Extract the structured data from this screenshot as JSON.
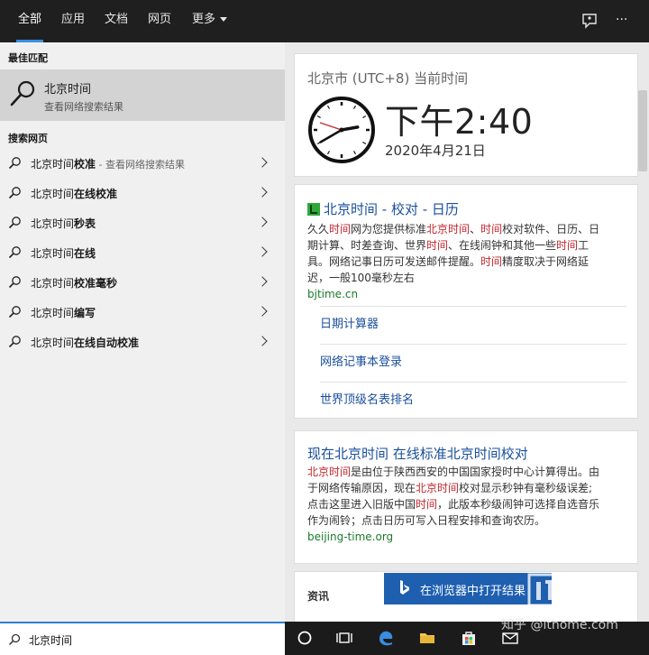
{
  "tabs": [
    {
      "label": "全部",
      "active": true
    },
    {
      "label": "应用",
      "active": false
    },
    {
      "label": "文档",
      "active": false
    },
    {
      "label": "网页",
      "active": false
    },
    {
      "label": "更多",
      "active": false
    }
  ],
  "top_icons": [
    "feedback-icon",
    "more-options-icon"
  ],
  "more_options_glyph": "···",
  "left": {
    "best_match_title": "最佳匹配",
    "best_match": {
      "name": "北京时间",
      "subtitle": "查看网络搜索结果",
      "icon": "search-icon"
    },
    "web_section_title": "搜索网页",
    "web_items": [
      {
        "prefix": "北京时间",
        "bold": "校准",
        "hint": " - 查看网络搜索结果"
      },
      {
        "prefix": "北京时间",
        "bold": "在线校准",
        "hint": ""
      },
      {
        "prefix": "北京时间",
        "bold": "秒表",
        "hint": ""
      },
      {
        "prefix": "北京时间",
        "bold": "在线",
        "hint": ""
      },
      {
        "prefix": "北京时间",
        "bold": "校准毫秒",
        "hint": ""
      },
      {
        "prefix": "北京时间",
        "bold": "编写",
        "hint": ""
      },
      {
        "prefix": "北京时间",
        "bold": "在线自动校准",
        "hint": ""
      }
    ]
  },
  "search": {
    "value": "北京时间"
  },
  "clock_card": {
    "place": "北京市 (UTC+8) 当前时间",
    "time": "下午2:40",
    "date": "2020年4月21日",
    "clock_hour": 14,
    "clock_minute": 40
  },
  "result1": {
    "title": "北京时间 - 校对 - 日历",
    "desc_lines": [
      [
        {
          "t": "久久",
          "h": false
        },
        {
          "t": "时间",
          "h": true
        },
        {
          "t": "网为您提供标准",
          "h": false
        },
        {
          "t": "北京时间",
          "h": true
        },
        {
          "t": "、",
          "h": false
        },
        {
          "t": "时间",
          "h": true
        },
        {
          "t": "校对软件、日历、日",
          "h": false
        }
      ],
      [
        {
          "t": "期计算、时差查询、世界",
          "h": false
        },
        {
          "t": "时间",
          "h": true
        },
        {
          "t": "、在线闹钟和其他一些",
          "h": false
        },
        {
          "t": "时间",
          "h": true
        },
        {
          "t": "工",
          "h": false
        }
      ],
      [
        {
          "t": "具。网络记事日历可发送邮件提醒。",
          "h": false
        },
        {
          "t": "时间",
          "h": true
        },
        {
          "t": "精度取决于网络延",
          "h": false
        }
      ],
      [
        {
          "t": "迟，一般100毫秒左右",
          "h": false
        }
      ]
    ],
    "url": "bjtime.cn",
    "sublinks": [
      "日期计算器",
      "网络记事本登录",
      "世界顶级名表排名"
    ]
  },
  "result2": {
    "title": "现在北京时间 在线标准北京时间校对",
    "desc_lines": [
      [
        {
          "t": "北京时间",
          "h": true
        },
        {
          "t": "是由位于陕西西安的中国国家授时中心计算得出。由",
          "h": false
        }
      ],
      [
        {
          "t": "于网络传输原因，现在",
          "h": false
        },
        {
          "t": "北京时间",
          "h": true
        },
        {
          "t": "校对显示秒钟有毫秒级误差;",
          "h": false
        }
      ],
      [
        {
          "t": "点击这里进入旧版中国",
          "h": false
        },
        {
          "t": "时间",
          "h": true
        },
        {
          "t": "，此版本秒级闹钟可选择自选音乐",
          "h": false
        }
      ],
      [
        {
          "t": "作为闹铃；点击日历可写入日程安排和查询农历。",
          "h": false
        }
      ]
    ],
    "url": "beijing-time.org"
  },
  "news": {
    "label": "资讯"
  },
  "open_browser": {
    "label": "在浏览器中打开结果",
    "icon": "bing-icon"
  },
  "taskbar_icons": [
    "cortana-icon",
    "task-view-icon",
    "edge-icon",
    "file-explorer-icon",
    "store-icon",
    "mail-icon"
  ],
  "watermark": {
    "text": "知乎 @ithome.com"
  },
  "colors": {
    "accent": "#3b8fe0",
    "link": "#1a4f9c",
    "highlight": "#c0262d",
    "url": "#1d7a2c",
    "button": "#1e5fb0"
  }
}
